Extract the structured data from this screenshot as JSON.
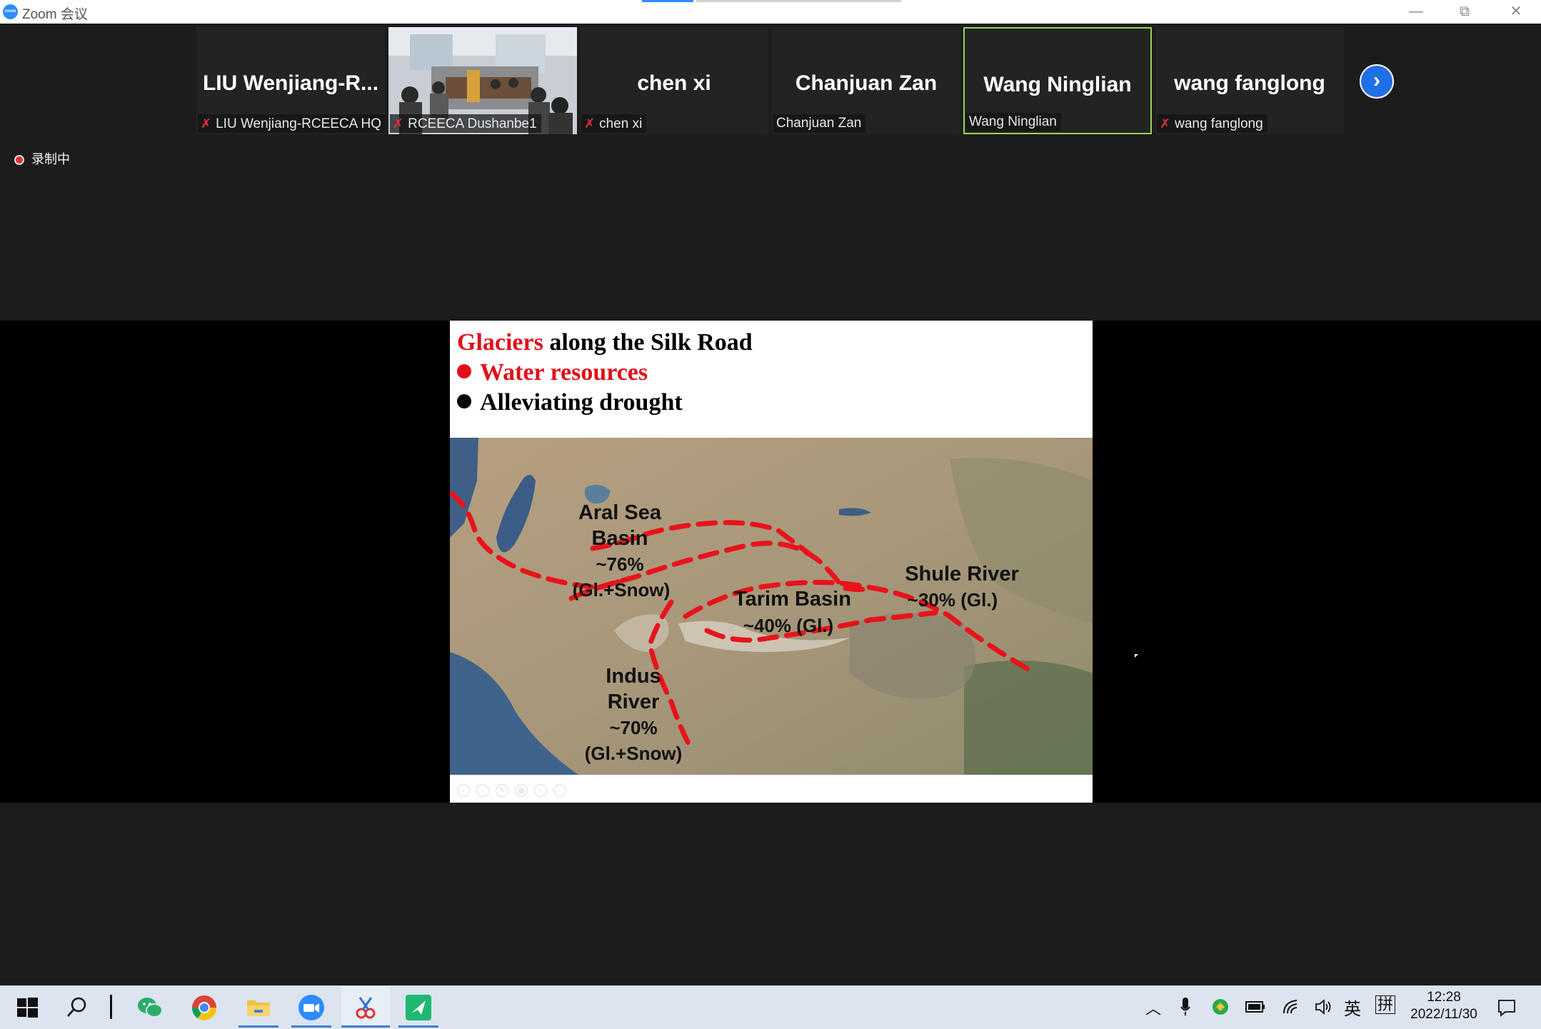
{
  "window": {
    "app_title": "Zoom 会议",
    "logo_text": "zoom",
    "controls": {
      "minimize": "—",
      "restore": "⧉",
      "close": "✕"
    }
  },
  "gallery": {
    "participants": [
      {
        "display": "LIU  Wenjiang-R...",
        "label": "LIU Wenjiang-RCEECA HQ",
        "muted": true,
        "video": false,
        "active": false
      },
      {
        "display": "",
        "label": "RCEECA Dushanbe1",
        "muted": true,
        "video": true,
        "active": false
      },
      {
        "display": "chen xi",
        "label": "chen xi",
        "muted": true,
        "video": false,
        "active": false
      },
      {
        "display": "Chanjuan Zan",
        "label": "Chanjuan Zan",
        "muted": false,
        "video": false,
        "active": false
      },
      {
        "display": "Wang Ninglian",
        "label": "Wang Ninglian",
        "muted": false,
        "video": false,
        "active": true
      },
      {
        "display": "wang fanglong",
        "label": "wang fanglong",
        "muted": true,
        "video": false,
        "active": false
      }
    ],
    "next_icon": "chevron-right-icon"
  },
  "recording": {
    "label": "录制中",
    "color": "#e0333a"
  },
  "slide": {
    "title_highlight": "Glaciers",
    "title_rest": " along the Silk Road",
    "bullets": [
      {
        "text": "Water resources",
        "color": "#e0101a"
      },
      {
        "text": "Alleviating drought",
        "color": "#000000"
      }
    ],
    "map_labels": {
      "aral_1": "Aral Sea",
      "aral_2": "Basin",
      "aral_3": "~76%",
      "aral_4": "(Gl.+Snow)",
      "tarim_1": "Tarim Basin",
      "tarim_2": "~40% (Gl.)",
      "shule_1": "Shule River",
      "shule_2": "~30% (Gl.)",
      "indus_1": "Indus",
      "indus_2": "River",
      "indus_3": "~70%",
      "indus_4": "(Gl.+Snow)"
    },
    "route_color": "#e8131b"
  },
  "taskbar": {
    "time": "12:28",
    "date": "2022/11/30",
    "ime_lang": "英",
    "ime_mode": "拼",
    "icons": [
      "windows-start-icon",
      "search-icon",
      "wechat-icon",
      "chrome-icon",
      "file-explorer-icon",
      "zoom-icon",
      "snipping-tool-icon",
      "green-app-icon"
    ]
  }
}
